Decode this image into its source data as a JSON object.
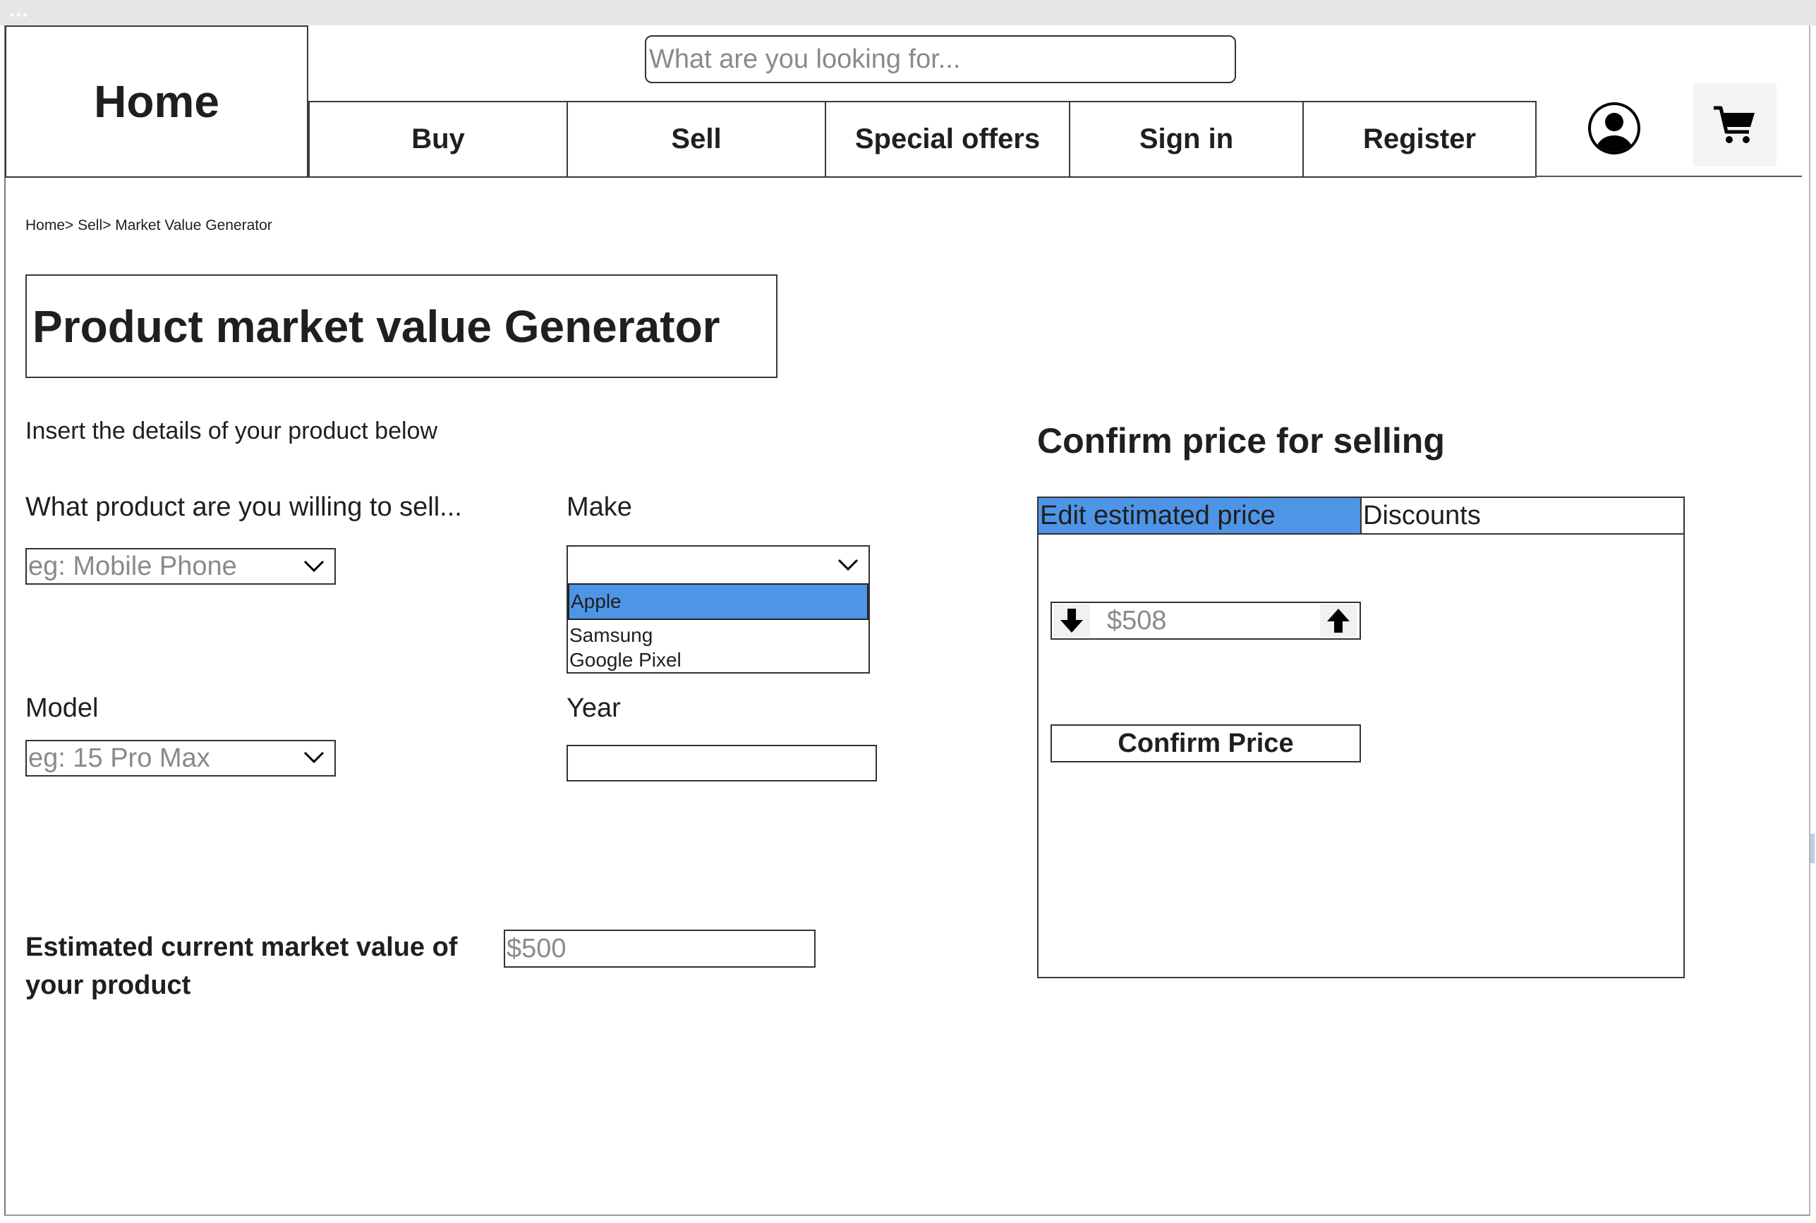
{
  "window": {
    "dots": "•••"
  },
  "header": {
    "home_label": "Home",
    "search_placeholder": "What are you looking for...",
    "nav": [
      "Buy",
      "Sell",
      "Special offers",
      "Sign in",
      "Register"
    ]
  },
  "icons": {
    "user": "user-circle-icon",
    "cart": "shopping-cart-icon",
    "chevron": "chevron-down-icon",
    "arrow_down": "arrow-down-icon",
    "arrow_up": "arrow-up-icon"
  },
  "breadcrumb": "Home> Sell> Market Value Generator",
  "page_title": "Product market value Generator",
  "intro": "Insert the details of your product below",
  "form": {
    "product": {
      "label": "What product are you willing to sell...",
      "placeholder": "eg: Mobile Phone"
    },
    "make": {
      "label": "Make",
      "value": "",
      "options": [
        "Apple",
        "Samsung",
        "Google Pixel"
      ],
      "highlighted": "Apple"
    },
    "model": {
      "label": "Model",
      "placeholder": "eg: 15 Pro Max"
    },
    "year": {
      "label": "Year",
      "value": ""
    },
    "estimate": {
      "label": "Estimated current market value of your product",
      "placeholder": "$500"
    }
  },
  "confirm_panel": {
    "heading": "Confirm price for selling",
    "tabs": [
      "Edit estimated price",
      "Discounts"
    ],
    "active_tab": "Edit estimated price",
    "price_placeholder": "$508",
    "confirm_label": "Confirm Price"
  },
  "colors": {
    "accent": "#4f95e6",
    "text": "#1f1f1f",
    "placeholder": "#8a8a8a",
    "border": "#333333"
  }
}
